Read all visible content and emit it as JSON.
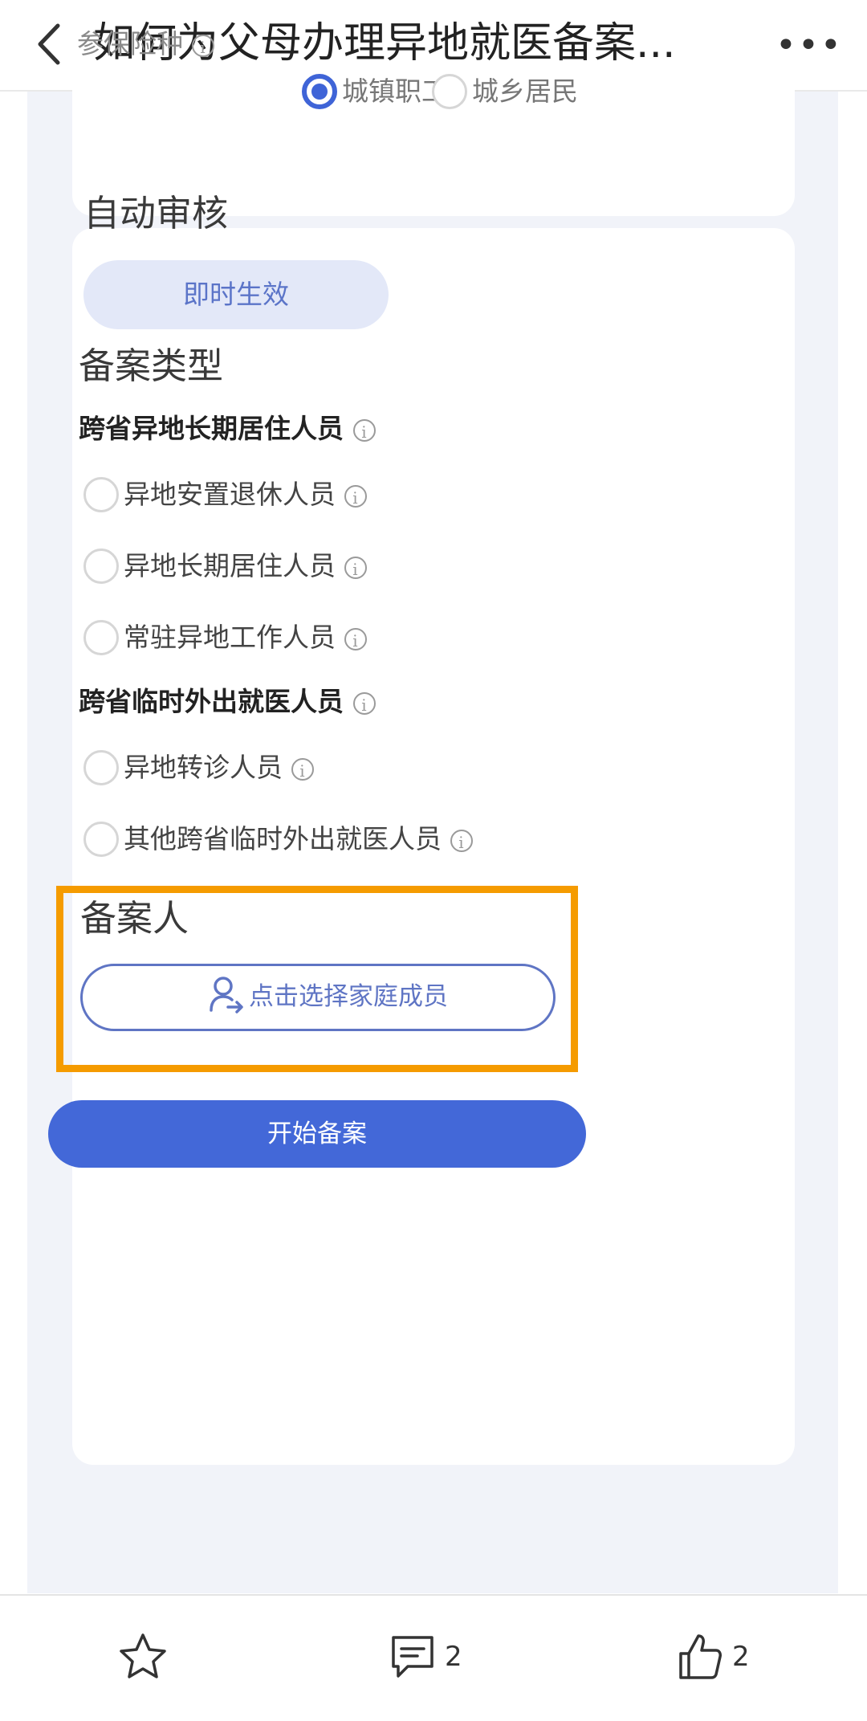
{
  "topbar": {
    "title": "如何为父母办理异地就医备案...",
    "back_icon": "chevron-left-icon",
    "more_icon": "more-dots-icon",
    "more_glyph": "•••"
  },
  "insurance": {
    "label": "参保险种",
    "info_glyph": "i",
    "options": [
      {
        "label": "城镇职工",
        "selected": true
      },
      {
        "label": "城乡居民",
        "selected": false
      }
    ]
  },
  "auto_review": {
    "title": "自动审核",
    "pill": "即时生效"
  },
  "record_type": {
    "title": "备案类型",
    "groups": [
      {
        "title": "跨省异地长期居住人员",
        "options": [
          "异地安置退休人员",
          "异地长期居住人员",
          "常驻异地工作人员"
        ]
      },
      {
        "title": "跨省临时外出就医人员",
        "options": [
          "异地转诊人员",
          "其他跨省临时外出就医人员"
        ]
      }
    ]
  },
  "registrant": {
    "title": "备案人",
    "select_button": "点击选择家庭成员",
    "icon": "person-arrow-icon"
  },
  "start_button": "开始备案",
  "bottombar": {
    "favorite_icon": "star-icon",
    "comment_icon": "comment-icon",
    "comment_count": "2",
    "like_icon": "thumbs-up-icon",
    "like_count": "2"
  },
  "colors": {
    "accent": "#4368d8",
    "highlight": "#f59b00",
    "page_bg": "#f1f3f9"
  }
}
